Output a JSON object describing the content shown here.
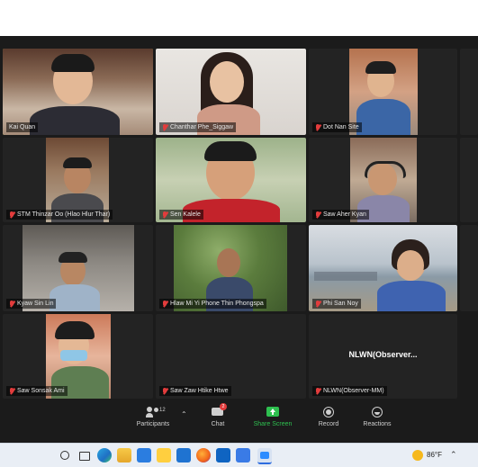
{
  "meeting": {
    "tiles": [
      {
        "name": "Kai Quan",
        "active": true
      },
      {
        "name": "Chanthar Phe_Siggaw",
        "active": false
      },
      {
        "name": "Dot Nan Site",
        "active": false
      },
      {
        "name": "STM Thinzar Oo (Hlao Hlur Thar)",
        "active": false
      },
      {
        "name": "Sen Kalele",
        "active": false
      },
      {
        "name": "Saw Aher Kyan",
        "active": false
      },
      {
        "name": "Kyaw Sin Lin",
        "active": false
      },
      {
        "name": "Hlaw Mi Yi Phone Thin Phongspa",
        "active": false
      },
      {
        "name": "Phi San Noy",
        "active": false
      },
      {
        "name": "Saw Sonsak Ami",
        "active": false
      },
      {
        "name": "Saw Zaw Htike Htwe",
        "active": false
      },
      {
        "name": "NLWN(Observer-MM)",
        "active": false,
        "caption": "NLWN(Observer..."
      }
    ]
  },
  "toolbar": {
    "participants_label": "Participants",
    "participants_count": "12",
    "chat_label": "Chat",
    "chat_badge": "2",
    "share_label": "Share Screen",
    "record_label": "Record",
    "reactions_label": "Reactions"
  },
  "taskbar": {
    "weather_temp": "86°F"
  },
  "colors": {
    "active_speaker": "#b8d94a",
    "share_green": "#2ec04f",
    "mute_red": "#e23c3c",
    "badge_red": "#e23c3c"
  }
}
